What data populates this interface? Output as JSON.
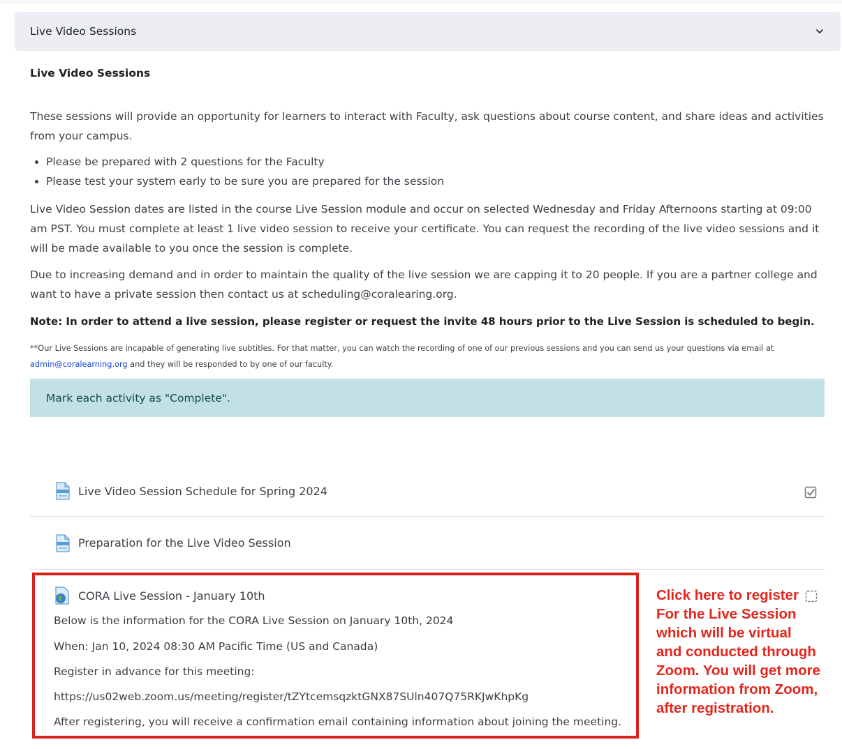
{
  "section": {
    "header_title": "Live Video Sessions",
    "heading": "Live Video Sessions"
  },
  "intro": "These sessions will provide an opportunity for learners to interact with Faculty, ask questions about course content, and share ideas and activities from your campus.",
  "bullets": [
    "Please be prepared with 2 questions for the Faculty",
    "Please test your system early to be sure you are prepared for the session"
  ],
  "dates_text": "Live Video Session dates are listed in the course Live Session module and occur on selected Wednesday and Friday Afternoons starting at 09:00 am PST. You must complete at least 1 live video session to receive your certificate. You can request the recording of the live video sessions and it will be made available to you once the session is complete.",
  "demand_text": "Due to increasing demand and in order to maintain the quality of the live session we are capping it to 20 people. If you are a partner college and want to have a private session then contact us at scheduling@coralearing.org.",
  "note": "Note: In order to attend a live session, please register or request the invite 48 hours prior to the Live Session is scheduled to begin.",
  "subtitles_note": {
    "before": "**Our Live Sessions are incapable of generating live subtitles. For that matter, you can watch the recording of one of our previous sessions and you can send us your questions via email at ",
    "email": "admin@coralearning.org",
    "after": " and they will be responded to by one of our faculty."
  },
  "alert": "Mark each activity as \"Complete\".",
  "activities": [
    {
      "name": "Live Video Session Schedule for Spring 2024",
      "icon": "page-icon"
    },
    {
      "name": "Preparation for the Live Video Session",
      "icon": "page-icon"
    }
  ],
  "zoom": {
    "title": "CORA Live Session - January 10th",
    "line1": "Below is the information for the CORA Live Session on January 10th, 2024",
    "line2": "When: Jan 10, 2024 08:30 AM Pacific Time (US and Canada)",
    "line3": "Register in advance for this meeting:",
    "link": "https://us02web.zoom.us/meeting/register/tZYtcemsqzktGNX87SUln407Q75RKJwKhpKg",
    "line4": "After registering, you will receive a confirmation email containing information about joining the meeting."
  },
  "callout": {
    "lines": [
      "Click here to register",
      "For the Live Session",
      "which will be virtual",
      "and conducted through",
      "Zoom. You will get more",
      "information from Zoom,",
      "after registration."
    ]
  },
  "colors": {
    "accent_red": "#d9211b",
    "alert_bg": "#c2e1e4",
    "link": "#1747d6"
  }
}
